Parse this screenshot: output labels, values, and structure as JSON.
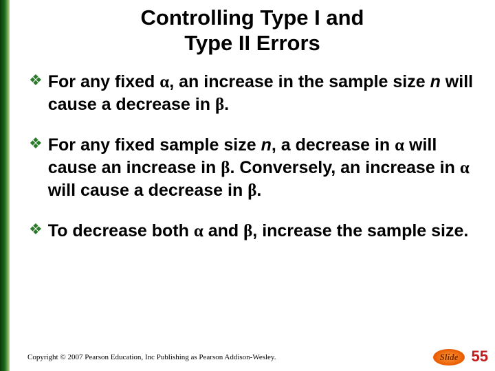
{
  "title_line1": "Controlling Type I and",
  "title_line2": "Type II Errors",
  "bullets": [
    {
      "pre": "For any fixed ",
      "sym1": "α",
      "mid1": ", an increase in the sample size ",
      "ital1": "n",
      "mid2": " will cause a decrease in ",
      "sym2": "β",
      "post": "."
    },
    {
      "pre": "For any fixed sample size ",
      "ital1": "n",
      "mid1": ", a decrease in ",
      "sym1": "α",
      "mid2": " will cause an increase in ",
      "sym2": "β",
      "mid3": ".  Conversely, an increase in ",
      "sym3": "α",
      "mid4": " will cause a decrease in ",
      "sym4": "β",
      "post": "."
    },
    {
      "pre": "To decrease both ",
      "sym1": "α",
      "mid1": " and ",
      "sym2": "β",
      "post": ", increase the sample size."
    }
  ],
  "copyright": "Copyright © 2007 Pearson Education, Inc Publishing as Pearson Addison-Wesley.",
  "slide_label": "Slide",
  "page_number": "55"
}
